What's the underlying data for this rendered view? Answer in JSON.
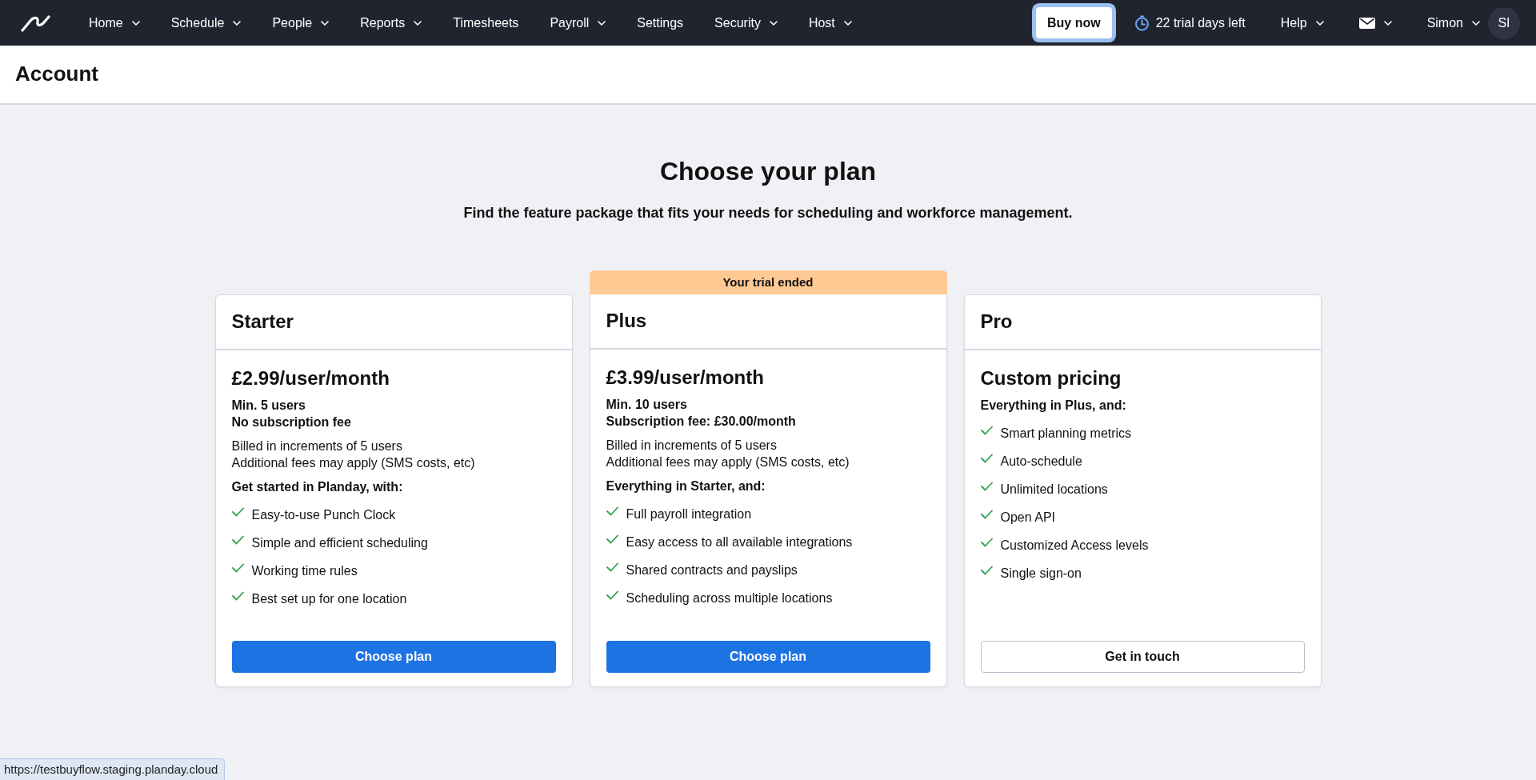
{
  "navbar": {
    "menu": [
      {
        "label": "Home",
        "dropdown": true
      },
      {
        "label": "Schedule",
        "dropdown": true
      },
      {
        "label": "People",
        "dropdown": true
      },
      {
        "label": "Reports",
        "dropdown": true
      },
      {
        "label": "Timesheets",
        "dropdown": false
      },
      {
        "label": "Payroll",
        "dropdown": true
      },
      {
        "label": "Settings",
        "dropdown": false
      },
      {
        "label": "Security",
        "dropdown": true
      },
      {
        "label": "Host",
        "dropdown": true
      }
    ],
    "buy_button": {
      "label": "Buy now",
      "focused": true
    },
    "trial": "22 trial days left",
    "help": {
      "label": "Help",
      "dropdown": true
    },
    "mail": {
      "dropdown": true
    },
    "user": {
      "name": "Simon",
      "dropdown": true,
      "initials": "SI"
    }
  },
  "page_header": {
    "title": "Account"
  },
  "intro": {
    "title": "Choose your plan",
    "subtitle": "Find the feature package that fits your needs for scheduling and workforce management."
  },
  "plans": [
    {
      "name": "Starter",
      "price": "£2.99/user/month",
      "terms": [
        "Min. 5 users",
        "No subscription fee"
      ],
      "notes": [
        "Billed in increments of 5 users",
        "Additional fees may apply (SMS costs, etc)"
      ],
      "features_heading": "Get started in Planday, with:",
      "features": [
        "Easy-to-use Punch Clock",
        "Simple and efficient scheduling",
        "Working time rules",
        "Best set up for one location"
      ],
      "button": {
        "label": "Choose plan",
        "kind": "primary"
      }
    },
    {
      "banner": "Your trial ended",
      "name": "Plus",
      "price": "£3.99/user/month",
      "terms": [
        "Min. 10 users",
        "Subscription fee: £30.00/month"
      ],
      "notes": [
        "Billed in increments of 5 users",
        "Additional fees may apply (SMS costs, etc)"
      ],
      "features_heading": "Everything in Starter, and:",
      "features": [
        "Full payroll integration",
        "Easy access to all available integrations",
        "Shared contracts and payslips",
        "Scheduling across multiple locations"
      ],
      "button": {
        "label": "Choose plan",
        "kind": "primary"
      }
    },
    {
      "name": "Pro",
      "price": "Custom pricing",
      "features_heading": "Everything in Plus, and:",
      "features": [
        "Smart planning metrics",
        "Auto-schedule",
        "Unlimited locations",
        "Open API",
        "Customized Access levels",
        "Single sign-on"
      ],
      "button": {
        "label": "Get in touch",
        "kind": "outline"
      }
    }
  ],
  "status_url": "https://testbuyflow.staging.planday.cloud"
}
